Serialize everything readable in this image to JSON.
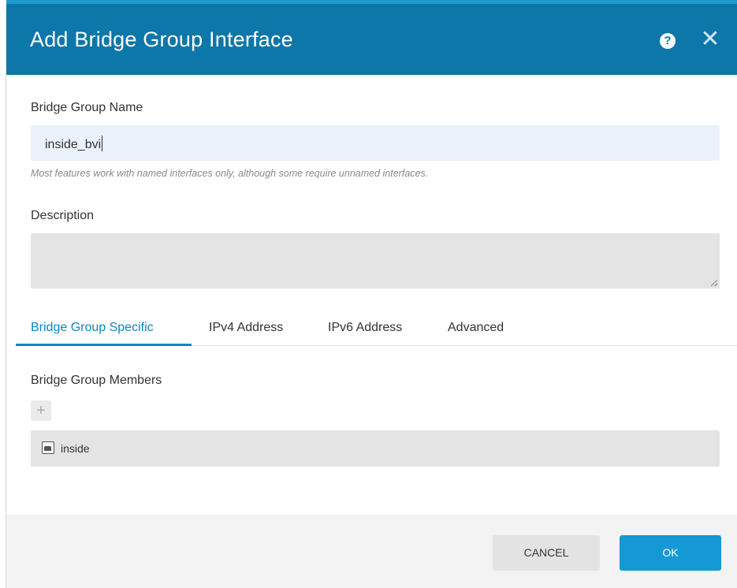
{
  "dialog": {
    "title": "Add Bridge Group Interface",
    "help_icon": "question-circle-icon",
    "close_icon": "close-icon",
    "close_glyph": "✕",
    "help_glyph": "?"
  },
  "form": {
    "name_label": "Bridge Group Name",
    "name_value": "inside_bvi",
    "name_hint": "Most features work with named interfaces only, although some require unnamed interfaces.",
    "description_label": "Description",
    "description_value": ""
  },
  "tabs": [
    {
      "label": "Bridge Group Specific",
      "active": true
    },
    {
      "label": "IPv4 Address",
      "active": false
    },
    {
      "label": "IPv6 Address",
      "active": false
    },
    {
      "label": "Advanced",
      "active": false
    }
  ],
  "members": {
    "label": "Bridge Group Members",
    "add_glyph": "+",
    "items": [
      {
        "icon": "interface-icon",
        "label": "inside"
      }
    ]
  },
  "footer": {
    "cancel_label": "CANCEL",
    "ok_label": "OK"
  },
  "colors": {
    "header": "#0c77a8",
    "accent": "#0a86c5",
    "ok_button": "#1599d4"
  }
}
